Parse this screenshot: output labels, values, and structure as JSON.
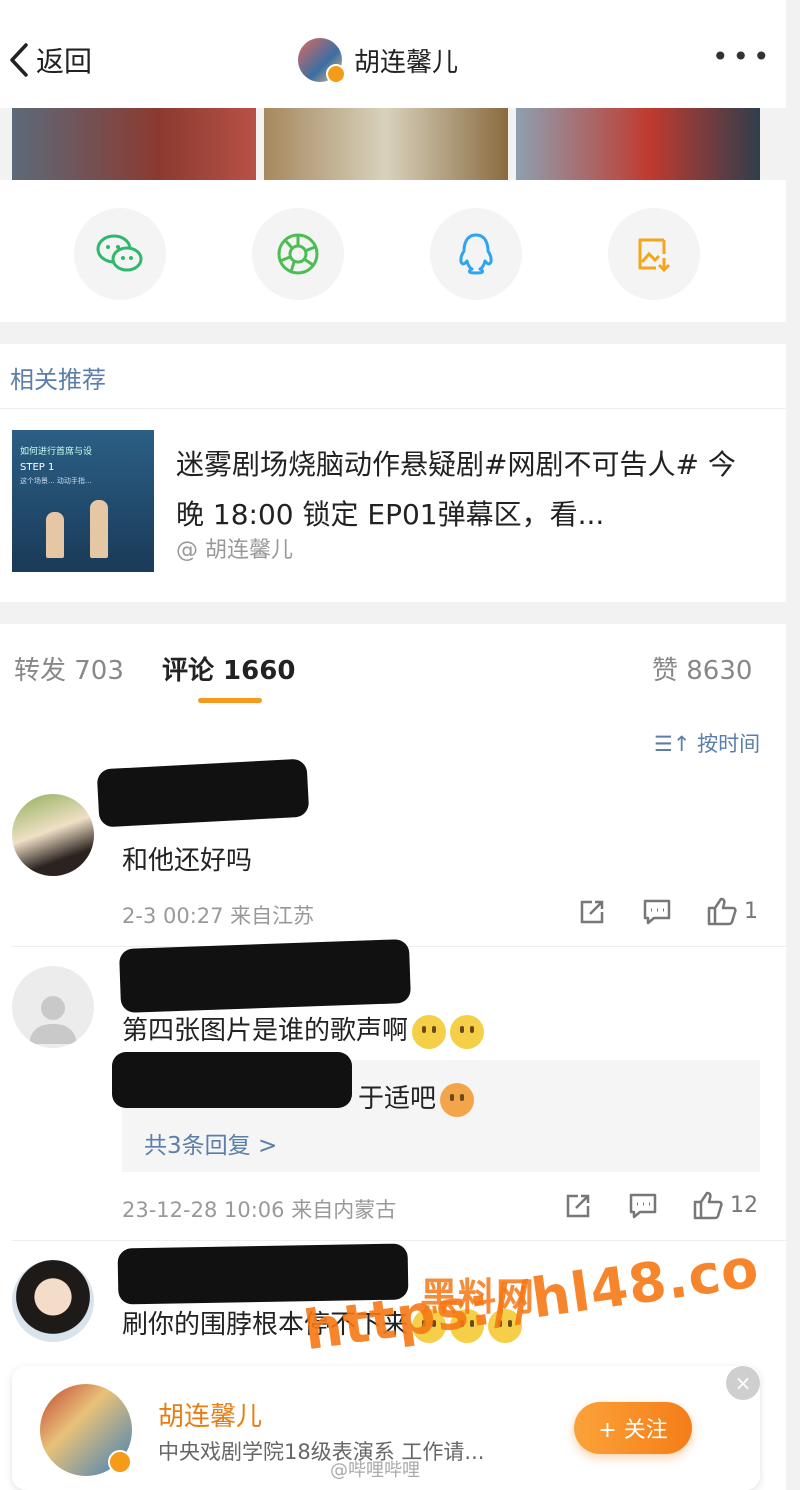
{
  "header": {
    "back_label": "返回",
    "title": "胡连馨儿",
    "more": "•••"
  },
  "share": [
    "wechat-icon",
    "moments-icon",
    "qq-icon",
    "save-image-icon"
  ],
  "related": {
    "heading": "相关推荐",
    "text": "迷雾剧场烧脑动作悬疑剧#网剧不可告人# 今晚 18:00 锁定 EP01弹幕区，看...",
    "author": "@ 胡连馨儿",
    "thumb": {
      "line1": "如何进行首席与设",
      "line2": "STEP 1",
      "line3": "这个场景... 动动手指..."
    }
  },
  "tabs": {
    "repost": "转发 703",
    "comments": "评论 1660",
    "likes": "赞 8630"
  },
  "sort_label": "按时间",
  "comments": [
    {
      "text": "和他还好吗",
      "meta": "2-3 00:27 来自江苏",
      "likes": "1"
    },
    {
      "text": "第四张图片是谁的歌声啊",
      "meta": "23-12-28 10:06 来自内蒙古",
      "likes": "12",
      "reply_text": "于适吧",
      "reply_more": "共3条回复 >"
    },
    {
      "text": "刷你的围脖根本停不下来"
    }
  ],
  "follow_card": {
    "name": "胡连馨儿",
    "desc": "中央戏剧学院18级表演系  工作请...",
    "button": "+ 关注",
    "close": "×"
  },
  "watermarks": {
    "w1": "黑料网",
    "w2": "https://hl48.co",
    "w3": "@哔哩哔哩"
  },
  "colors": {
    "accent": "#f59a1f",
    "link": "#5b7fa8",
    "brand_name": "#e87d14"
  }
}
